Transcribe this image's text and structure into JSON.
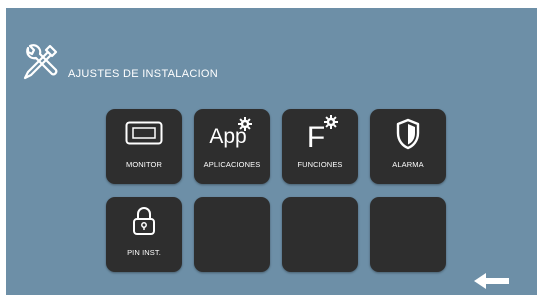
{
  "header": {
    "title": "AJUSTES DE INSTALACION",
    "icon": "tools-icon"
  },
  "tiles": [
    {
      "label": "MONITOR",
      "icon": "monitor-icon"
    },
    {
      "label": "APLICACIONES",
      "icon": "app-gear-icon",
      "glyph": "App"
    },
    {
      "label": "FUNCIONES",
      "icon": "function-gear-icon",
      "glyph": "F"
    },
    {
      "label": "ALARMA",
      "icon": "shield-icon"
    },
    {
      "label": "PIN INST.",
      "icon": "padlock-icon"
    },
    {
      "label": "",
      "icon": ""
    },
    {
      "label": "",
      "icon": ""
    },
    {
      "label": "",
      "icon": ""
    }
  ],
  "navigation": {
    "back": "back-arrow-icon"
  },
  "colors": {
    "background": "#6d8fa7",
    "tile": "#2e2e2e",
    "text": "#ffffff"
  }
}
